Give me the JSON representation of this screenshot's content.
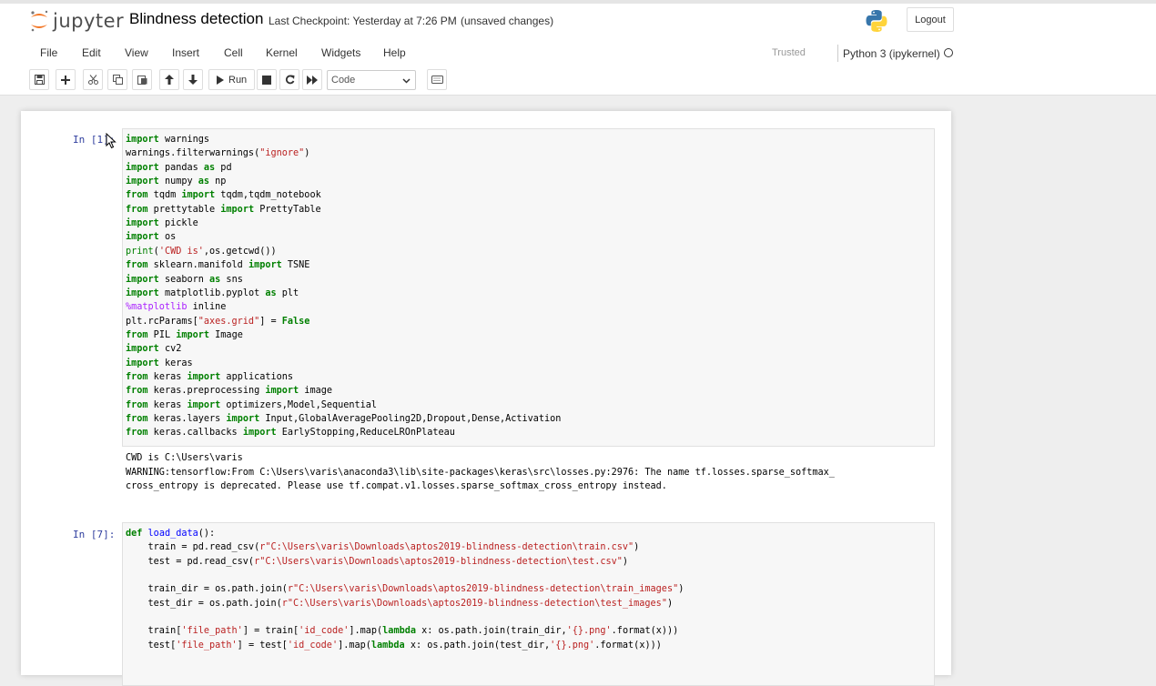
{
  "header": {
    "app_name": "jupyter",
    "notebook_title": "Blindness detection",
    "checkpoint": "Last Checkpoint: Yesterday at 7:26 PM",
    "unsaved": "(unsaved changes)",
    "logout_label": "Logout",
    "kernel_logo_icon": "python-logo-icon"
  },
  "menu": {
    "items": [
      "File",
      "Edit",
      "View",
      "Insert",
      "Cell",
      "Kernel",
      "Widgets",
      "Help"
    ],
    "trusted": "Trusted",
    "kernel_name": "Python 3 (ipykernel)"
  },
  "toolbar": {
    "run_label": "Run",
    "cell_type": "Code",
    "icons": [
      "save-icon",
      "plus-icon",
      "cut-icon",
      "copy-icon",
      "paste-icon",
      "arrow-up-icon",
      "arrow-down-icon",
      "play-icon",
      "stop-icon",
      "restart-icon",
      "fast-forward-icon",
      "keyboard-icon"
    ]
  },
  "cells": [
    {
      "prompt": "In [1]:",
      "lines": [
        [
          [
            "import",
            "kw"
          ],
          [
            " warnings",
            ""
          ]
        ],
        [
          [
            "warnings.filterwarnings(",
            ""
          ],
          [
            "\"ignore\"",
            "str"
          ],
          [
            ")",
            ""
          ]
        ],
        [
          [
            "import",
            "kw"
          ],
          [
            " pandas ",
            ""
          ],
          [
            "as",
            "kw"
          ],
          [
            " pd",
            ""
          ]
        ],
        [
          [
            "import",
            "kw"
          ],
          [
            " numpy ",
            ""
          ],
          [
            "as",
            "kw"
          ],
          [
            " np",
            ""
          ]
        ],
        [
          [
            "from",
            "kw"
          ],
          [
            " tqdm ",
            ""
          ],
          [
            "import",
            "kw"
          ],
          [
            " tqdm,tqdm_notebook",
            ""
          ]
        ],
        [
          [
            "from",
            "kw"
          ],
          [
            " prettytable ",
            ""
          ],
          [
            "import",
            "kw"
          ],
          [
            " PrettyTable",
            ""
          ]
        ],
        [
          [
            "import",
            "kw"
          ],
          [
            " pickle",
            ""
          ]
        ],
        [
          [
            "import",
            "kw"
          ],
          [
            " os",
            ""
          ]
        ],
        [
          [
            "print",
            "bi"
          ],
          [
            "(",
            ""
          ],
          [
            "'CWD is'",
            "str"
          ],
          [
            ",os.getcwd())",
            ""
          ]
        ],
        [
          [
            "from",
            "kw"
          ],
          [
            " sklearn.manifold ",
            ""
          ],
          [
            "import",
            "kw"
          ],
          [
            " TSNE",
            ""
          ]
        ],
        [
          [
            "import",
            "kw"
          ],
          [
            " seaborn ",
            ""
          ],
          [
            "as",
            "kw"
          ],
          [
            " sns",
            ""
          ]
        ],
        [
          [
            "import",
            "kw"
          ],
          [
            " matplotlib.pyplot ",
            ""
          ],
          [
            "as",
            "kw"
          ],
          [
            " plt",
            ""
          ]
        ],
        [
          [
            "%matplotlib",
            "mg"
          ],
          [
            " inline",
            ""
          ]
        ],
        [
          [
            "plt.rcParams[",
            ""
          ],
          [
            "\"axes.grid\"",
            "str"
          ],
          [
            "] = ",
            ""
          ],
          [
            "False",
            "kw"
          ]
        ],
        [
          [
            "from",
            "kw"
          ],
          [
            " PIL ",
            ""
          ],
          [
            "import",
            "kw"
          ],
          [
            " Image",
            ""
          ]
        ],
        [
          [
            "import",
            "kw"
          ],
          [
            " cv2",
            ""
          ]
        ],
        [
          [
            "import",
            "kw"
          ],
          [
            " keras",
            ""
          ]
        ],
        [
          [
            "from",
            "kw"
          ],
          [
            " keras ",
            ""
          ],
          [
            "import",
            "kw"
          ],
          [
            " applications",
            ""
          ]
        ],
        [
          [
            "from",
            "kw"
          ],
          [
            " keras.preprocessing ",
            ""
          ],
          [
            "import",
            "kw"
          ],
          [
            " image",
            ""
          ]
        ],
        [
          [
            "from",
            "kw"
          ],
          [
            " keras ",
            ""
          ],
          [
            "import",
            "kw"
          ],
          [
            " optimizers,Model,Sequential",
            ""
          ]
        ],
        [
          [
            "from",
            "kw"
          ],
          [
            " keras.layers ",
            ""
          ],
          [
            "import",
            "kw"
          ],
          [
            " Input,GlobalAveragePooling2D,Dropout,Dense,Activation",
            ""
          ]
        ],
        [
          [
            "from",
            "kw"
          ],
          [
            " keras.callbacks ",
            ""
          ],
          [
            "import",
            "kw"
          ],
          [
            " EarlyStopping,ReduceLROnPlateau",
            ""
          ]
        ]
      ],
      "output": [
        "CWD is C:\\Users\\varis",
        "WARNING:tensorflow:From C:\\Users\\varis\\anaconda3\\lib\\site-packages\\keras\\src\\losses.py:2976: The name tf.losses.sparse_softmax_",
        "cross_entropy is deprecated. Please use tf.compat.v1.losses.sparse_softmax_cross_entropy instead."
      ]
    },
    {
      "prompt": "In [7]:",
      "lines": [
        [
          [
            "def",
            "kw"
          ],
          [
            " ",
            ""
          ],
          [
            "load_data",
            "fn"
          ],
          [
            "():",
            ""
          ]
        ],
        [
          [
            "    train = pd.read_csv(",
            ""
          ],
          [
            "r\"C:\\Users\\varis\\Downloads\\aptos2019-blindness-detection\\train.csv\"",
            "str"
          ],
          [
            ")",
            ""
          ]
        ],
        [
          [
            "    test = pd.read_csv(",
            ""
          ],
          [
            "r\"C:\\Users\\varis\\Downloads\\aptos2019-blindness-detection\\test.csv\"",
            "str"
          ],
          [
            ")",
            ""
          ]
        ],
        [
          [
            "",
            ""
          ]
        ],
        [
          [
            "    train_dir = os.path.join(",
            ""
          ],
          [
            "r\"C:\\Users\\varis\\Downloads\\aptos2019-blindness-detection\\train_images\"",
            "str"
          ],
          [
            ")",
            ""
          ]
        ],
        [
          [
            "    test_dir = os.path.join(",
            ""
          ],
          [
            "r\"C:\\Users\\varis\\Downloads\\aptos2019-blindness-detection\\test_images\"",
            "str"
          ],
          [
            ")",
            ""
          ]
        ],
        [
          [
            "",
            ""
          ]
        ],
        [
          [
            "    train[",
            ""
          ],
          [
            "'file_path'",
            "str"
          ],
          [
            "] = train[",
            ""
          ],
          [
            "'id_code'",
            "str"
          ],
          [
            "].map(",
            ""
          ],
          [
            "lambda",
            "kw"
          ],
          [
            " x: os.path.join(train_dir,",
            ""
          ],
          [
            "'{}.png'",
            "str"
          ],
          [
            ".format(x)))",
            ""
          ]
        ],
        [
          [
            "    test[",
            ""
          ],
          [
            "'file_path'",
            "str"
          ],
          [
            "] = test[",
            ""
          ],
          [
            "'id_code'",
            "str"
          ],
          [
            "].map(",
            ""
          ],
          [
            "lambda",
            "kw"
          ],
          [
            " x: os.path.join(test_dir,",
            ""
          ],
          [
            "'{}.png'",
            "str"
          ],
          [
            ".format(x)))",
            ""
          ]
        ]
      ]
    }
  ]
}
